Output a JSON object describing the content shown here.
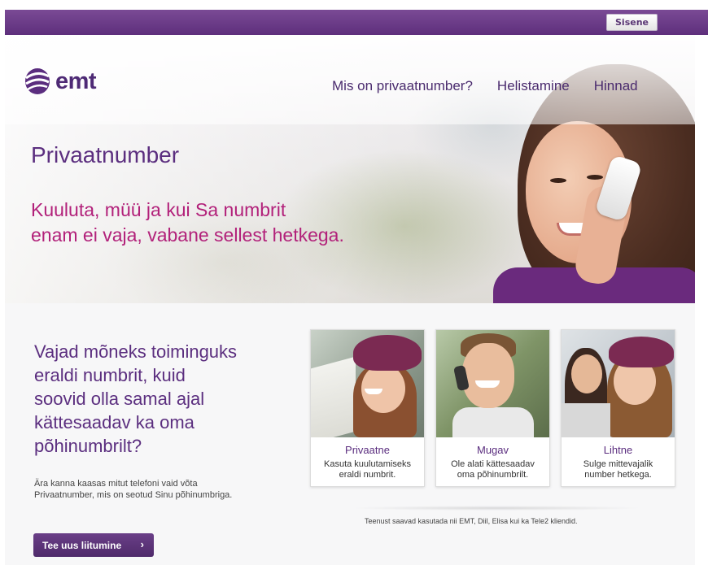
{
  "header": {
    "signin_label": "Sisene"
  },
  "brand": {
    "logo_text": "emt",
    "color": "#5b2e7f",
    "accent": "#b2217a"
  },
  "nav": [
    {
      "label": "Mis on privaatnumber?"
    },
    {
      "label": "Helistamine"
    },
    {
      "label": "Hinnad"
    }
  ],
  "hero": {
    "title": "Privaatnumber",
    "tagline_line1": "Kuuluta, müü ja kui Sa numbrit",
    "tagline_line2": "enam ei vaja, vabane sellest hetkega."
  },
  "intro": {
    "question_lines": [
      "Vajad mõneks toiminguks",
      "eraldi numbrit, kuid",
      "soovid olla samal ajal",
      "kättesaadav ka oma",
      "põhinumbrilt?"
    ],
    "sub_line1": "Ära kanna kaasas mitut telefoni vaid võta",
    "sub_line2": "Privaatnumber, mis on seotud Sinu põhinumbriga.",
    "cta_label": "Tee uus liitumine"
  },
  "cards": [
    {
      "title": "Privaatne",
      "desc_line1": "Kasuta kuulutamiseks",
      "desc_line2": "eraldi numbrit."
    },
    {
      "title": "Mugav",
      "desc_line1": "Ole alati kättesaadav",
      "desc_line2": "oma põhinumbrilt."
    },
    {
      "title": "Lihtne",
      "desc_line1": "Sulge mittevajalik",
      "desc_line2": "number hetkega."
    }
  ],
  "footer_note": "Teenust saavad kasutada nii EMT, Diil, Elisa kui ka Tele2 kliendid."
}
